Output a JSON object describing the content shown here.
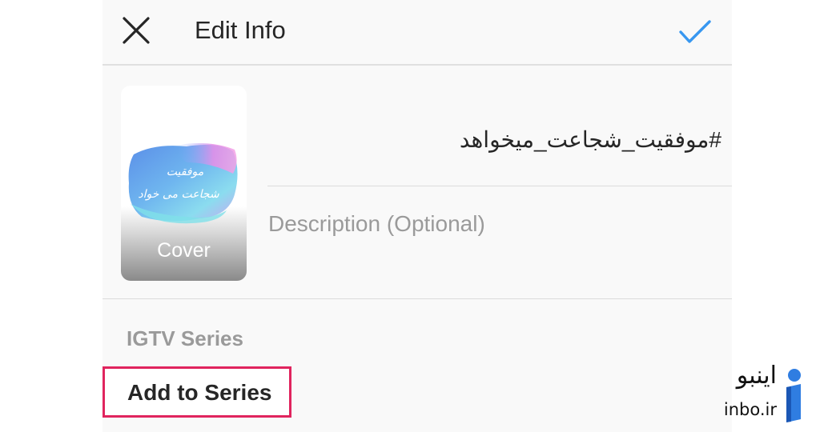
{
  "header": {
    "title": "Edit Info",
    "close_icon": "close-icon",
    "confirm_icon": "check-icon",
    "confirm_color": "#3897f0"
  },
  "cover": {
    "label": "Cover",
    "art_text_line1": "موفقیت",
    "art_text_line2": "شجاعت می خواد"
  },
  "title_field": {
    "value": "#موفقیت_شجاعت_میخواهد"
  },
  "description_field": {
    "placeholder": "Description (Optional)"
  },
  "series": {
    "section_label": "IGTV Series",
    "add_label": "Add to Series",
    "highlight_color": "#e0245e"
  },
  "watermark": {
    "persian": "اینبو",
    "latin": "inbo.ir",
    "icon": "inbo-logo-icon"
  }
}
